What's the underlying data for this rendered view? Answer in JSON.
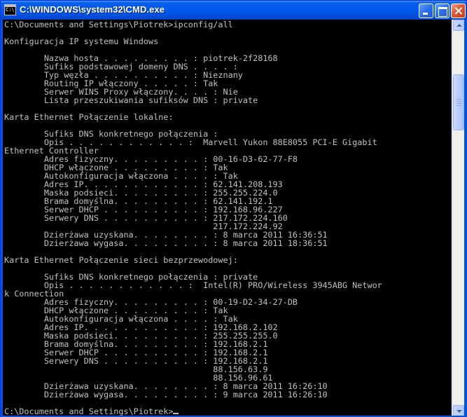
{
  "window": {
    "title": "C:\\WINDOWS\\system32\\CMD.exe",
    "icon": "cmd-icon",
    "icon_text": "C:\\"
  },
  "console": {
    "lines": [
      "C:\\Documents and Settings\\Piotrek>ipconfig/all",
      "",
      "Konfiguracja IP systemu Windows",
      "",
      "        Nazwa hosta . . . . . . . . . : piotrek-2f28168",
      "        Sufiks podstawowej domeny DNS . . . . :",
      "        Typ węzła . . . . . . . . . . : Nieznany",
      "        Routing IP włączony . . . . . : Tak",
      "        Serwer WINS Proxy włączony. . . . : Nie",
      "        Lista przeszukiwania sufiksów DNS : private",
      "",
      "Karta Ethernet Połączenie lokalne:",
      "",
      "        Sufiks DNS konkretnego połączenia :",
      "        Opis . . . . . . . . . . . . :  Marvell Yukon 88E8055 PCI-E Gigabit",
      "Ethernet Controller",
      "        Adres fizyczny. . . . . . . . . : 00-16-D3-62-77-F8",
      "        DHCP włączone . . . . . . . . . : Tak",
      "        Autokonfiguracja włączona . . . . : Tak",
      "        Adres IP. . . . . . . . . . . . : 62.141.208.193",
      "        Maska podsieci. . . . . . . . . : 255.255.224.0",
      "        Brama domyślna. . . . . . . . . : 62.141.192.1",
      "        Serwer DHCP . . . . . . . . . . : 192.168.96.227",
      "        Serwery DNS . . . . . . . . . . : 217.172.224.160",
      "                                          217.172.224.92",
      "        Dzierżawa uzyskana. . . . . . . . : 8 marca 2011 16:36:51",
      "        Dzierżawa wygasa. . . . . . . . . : 8 marca 2011 18:36:51",
      "",
      "Karta Ethernet Połączenie sieci bezprzewodowej:",
      "",
      "        Sufiks DNS konkretnego połączenia : private",
      "        Opis . . . . . . . . . . . . :  Intel(R) PRO/Wireless 3945ABG Networ",
      "k Connection",
      "        Adres fizyczny. . . . . . . . . : 00-19-D2-34-27-DB",
      "        DHCP włączone . . . . . . . . . : Tak",
      "        Autokonfiguracja włączona . . . . : Tak",
      "        Adres IP. . . . . . . . . . . . : 192.168.2.102",
      "        Maska podsieci. . . . . . . . . : 255.255.255.0",
      "        Brama domyślna. . . . . . . . . : 192.168.2.1",
      "        Serwer DHCP . . . . . . . . . . : 192.168.2.1",
      "        Serwery DNS . . . . . . . . . . : 192.168.2.1",
      "                                          88.156.63.9",
      "                                          88.156.96.61",
      "        Dzierżawa uzyskana. . . . . . . . : 8 marca 2011 16:26:10",
      "        Dzierżawa wygasa. . . . . . . . . : 9 marca 2011 16:26:10",
      "",
      "C:\\Documents and Settings\\Piotrek>"
    ]
  },
  "scrollbar": {
    "up_icon": "arrow-up-icon",
    "down_icon": "arrow-down-icon"
  },
  "colors": {
    "titlebar": "#0054e3",
    "console_bg": "#000000",
    "console_text": "#c0c0c0",
    "close_button": "#e0582f"
  }
}
